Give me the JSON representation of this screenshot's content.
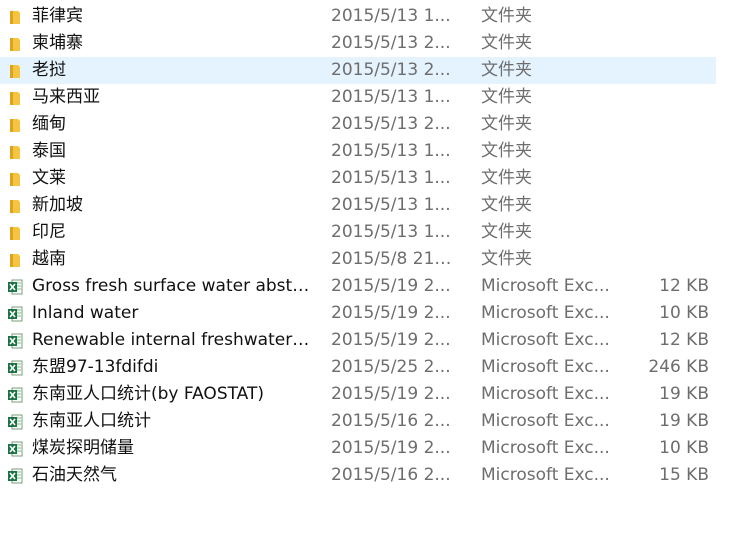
{
  "files": [
    {
      "name": "菲律宾",
      "date": "2015/5/13 1...",
      "type": "文件夹",
      "size": "",
      "icon": "folder-icon",
      "kind": "folder"
    },
    {
      "name": "柬埔寨",
      "date": "2015/5/13 2...",
      "type": "文件夹",
      "size": "",
      "icon": "folder-icon",
      "kind": "folder"
    },
    {
      "name": "老挝",
      "date": "2015/5/13 2...",
      "type": "文件夹",
      "size": "",
      "icon": "folder-icon",
      "kind": "folder",
      "selected": true
    },
    {
      "name": "马来西亚",
      "date": "2015/5/13 1...",
      "type": "文件夹",
      "size": "",
      "icon": "folder-icon",
      "kind": "folder"
    },
    {
      "name": "缅甸",
      "date": "2015/5/13 2...",
      "type": "文件夹",
      "size": "",
      "icon": "folder-icon",
      "kind": "folder"
    },
    {
      "name": "泰国",
      "date": "2015/5/13 1...",
      "type": "文件夹",
      "size": "",
      "icon": "folder-icon",
      "kind": "folder"
    },
    {
      "name": "文莱",
      "date": "2015/5/13 1...",
      "type": "文件夹",
      "size": "",
      "icon": "folder-icon",
      "kind": "folder"
    },
    {
      "name": "新加坡",
      "date": "2015/5/13 1...",
      "type": "文件夹",
      "size": "",
      "icon": "folder-icon",
      "kind": "folder"
    },
    {
      "name": "印尼",
      "date": "2015/5/13 1...",
      "type": "文件夹",
      "size": "",
      "icon": "folder-icon",
      "kind": "folder"
    },
    {
      "name": "越南",
      "date": "2015/5/8 21:...",
      "type": "文件夹",
      "size": "",
      "icon": "folder-icon",
      "kind": "folder"
    },
    {
      "name": "Gross fresh surface water abstr...",
      "date": "2015/5/19 2...",
      "type": "Microsoft Exc...",
      "size": "12 KB",
      "icon": "excel-file-icon",
      "kind": "excel"
    },
    {
      "name": "Inland water",
      "date": "2015/5/19 2...",
      "type": "Microsoft Exc...",
      "size": "10 KB",
      "icon": "excel-file-icon",
      "kind": "excel"
    },
    {
      "name": "Renewable internal freshwater ...",
      "date": "2015/5/19 2...",
      "type": "Microsoft Exc...",
      "size": "12 KB",
      "icon": "excel-file-icon",
      "kind": "excel"
    },
    {
      "name": "东盟97-13fdifdi",
      "date": "2015/5/25 2...",
      "type": "Microsoft Exc...",
      "size": "246 KB",
      "icon": "excel-file-icon",
      "kind": "excel"
    },
    {
      "name": "东南亚人口统计(by FAOSTAT)",
      "date": "2015/5/19 2...",
      "type": "Microsoft Exc...",
      "size": "19 KB",
      "icon": "excel-file-icon",
      "kind": "excel"
    },
    {
      "name": "东南亚人口统计",
      "date": "2015/5/16 2...",
      "type": "Microsoft Exc...",
      "size": "19 KB",
      "icon": "excel-file-icon",
      "kind": "excel"
    },
    {
      "name": "煤炭探明储量",
      "date": "2015/5/19 2...",
      "type": "Microsoft Exc...",
      "size": "10 KB",
      "icon": "excel-file-icon",
      "kind": "excel"
    },
    {
      "name": "石油天然气",
      "date": "2015/5/16 2...",
      "type": "Microsoft Exc...",
      "size": "15 KB",
      "icon": "excel-file-icon",
      "kind": "excel"
    }
  ],
  "colors": {
    "selected_bg": "#e5f3ff",
    "folder": "#f0c24a",
    "excel": "#1e7145"
  }
}
